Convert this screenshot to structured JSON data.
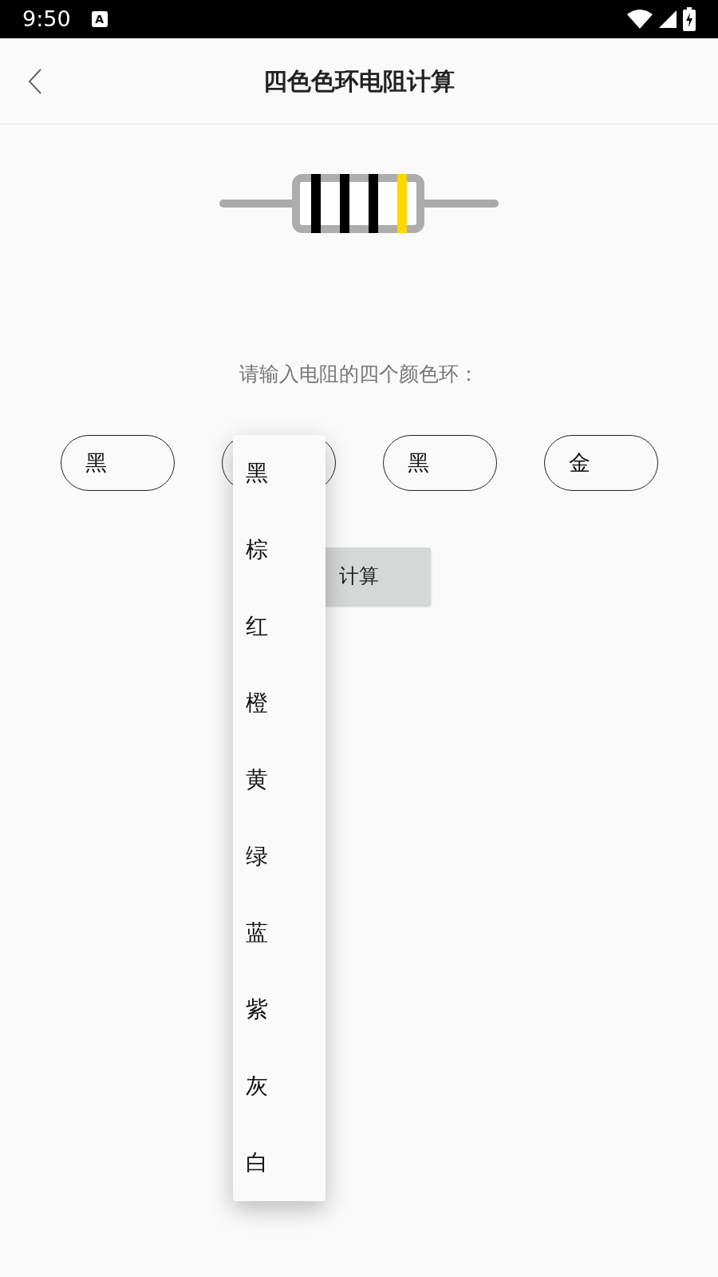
{
  "status_bar": {
    "time": "9:50",
    "notification_glyph": "A"
  },
  "app_bar": {
    "title": "四色色环电阻计算"
  },
  "resistor": {
    "bands": [
      {
        "color": "#000000"
      },
      {
        "color": "#000000"
      },
      {
        "color": "#000000"
      },
      {
        "color": "#ffd600"
      }
    ]
  },
  "prompt": "请输入电阻的四个颜色环：",
  "selects": [
    {
      "value": "黑",
      "open": false
    },
    {
      "open": true
    },
    {
      "value": "黑",
      "open": false
    },
    {
      "value": "金",
      "open": false
    }
  ],
  "calculate_button": "计算",
  "dropdown": {
    "options": [
      "黑",
      "棕",
      "红",
      "橙",
      "黄",
      "绿",
      "蓝",
      "紫",
      "灰",
      "白"
    ]
  }
}
